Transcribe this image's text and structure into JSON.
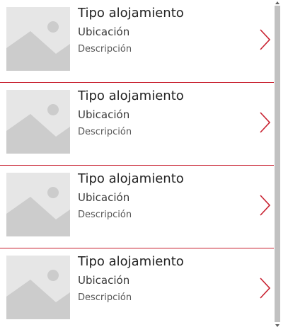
{
  "colors": {
    "accent": "#c8202f",
    "divider": "#c8202f",
    "placeholder_bg": "#e6e6e6",
    "placeholder_shape": "#cccccc",
    "scroll_thumb": "#c1c1c1"
  },
  "gallery": {
    "items": [
      {
        "title": "Tipo alojamiento",
        "subtitle": "Ubicación",
        "description": "Descripción",
        "image_icon": "image-placeholder-icon",
        "nav_icon": "chevron-right-icon"
      },
      {
        "title": "Tipo alojamiento",
        "subtitle": "Ubicación",
        "description": "Descripción",
        "image_icon": "image-placeholder-icon",
        "nav_icon": "chevron-right-icon"
      },
      {
        "title": "Tipo alojamiento",
        "subtitle": "Ubicación",
        "description": "Descripción",
        "image_icon": "image-placeholder-icon",
        "nav_icon": "chevron-right-icon"
      },
      {
        "title": "Tipo alojamiento",
        "subtitle": "Ubicación",
        "description": "Descripción",
        "image_icon": "image-placeholder-icon",
        "nav_icon": "chevron-right-icon"
      }
    ]
  },
  "scrollbar": {
    "up_icon": "scroll-up-arrow-icon",
    "down_icon": "scroll-down-arrow-icon"
  }
}
